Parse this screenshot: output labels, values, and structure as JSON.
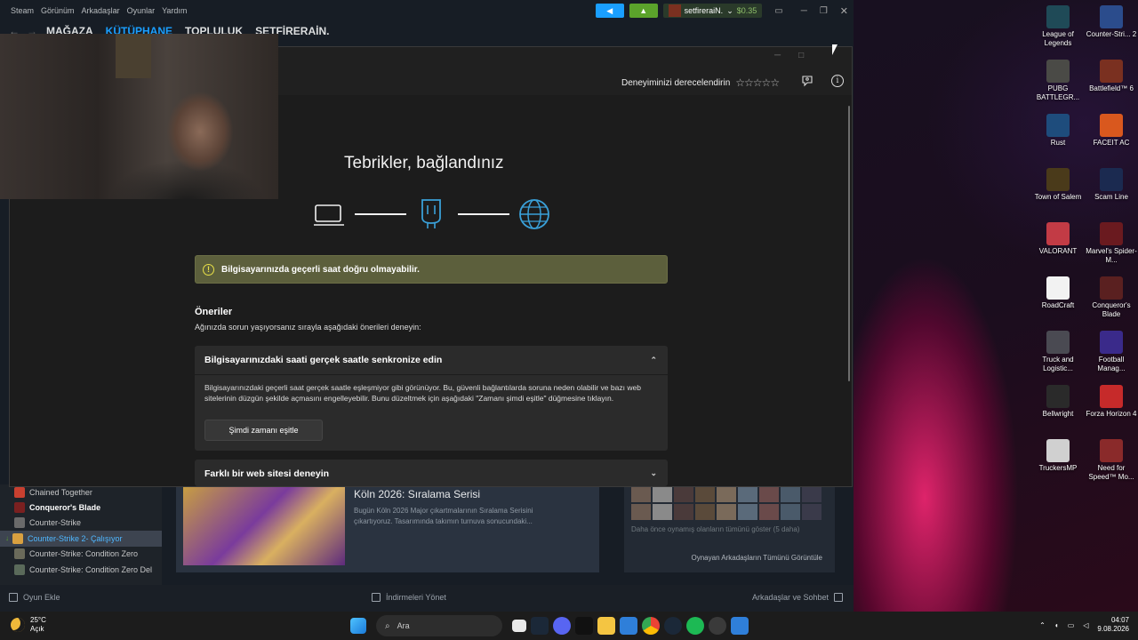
{
  "steam": {
    "menu": [
      "Steam",
      "Görünüm",
      "Arkadaşlar",
      "Oyunlar",
      "Yardım"
    ],
    "user": "setfireraiN.",
    "balance": "$0.35",
    "nav": [
      "MAĞAZA",
      "KÜTÜPHANE",
      "TOPLULUK",
      "SETFİRERAİN."
    ],
    "games": [
      {
        "name": "Chained Together",
        "status": ""
      },
      {
        "name": "Conqueror's Blade",
        "status": ""
      },
      {
        "name": "Counter-Strike",
        "status": ""
      },
      {
        "name": "Counter-Strike 2",
        "status": " - Çalışıyor"
      },
      {
        "name": "Counter-Strike: Condition Zero",
        "status": ""
      },
      {
        "name": "Counter-Strike: Condition Zero Del",
        "status": ""
      }
    ],
    "news": {
      "title": "Köln 2026: Sıralama Serisi",
      "desc": "Bugün Köln 2026 Major çıkartmalarının Sıralama Serisini çıkartıyoruz. Tasarımında takımın turnuva sonucundaki..."
    },
    "friends": {
      "note": "Daha önce oynamış olanların tümünü göster (5 daha)",
      "view_all": "Oynayan Arkadaşların Tümünü Görüntüle"
    },
    "status": {
      "add_game": "Oyun Ekle",
      "downloads": "İndirmeleri Yönet",
      "friends_chat": "Arkadaşlar ve Sohbet"
    }
  },
  "dialog": {
    "rate_label": "Deneyiminizi derecelendirin",
    "title": "Tebrikler, bağlandınız",
    "warning": "Bilgisayarınızda geçerli saat doğru olmayabilir.",
    "suggestions_title": "Öneriler",
    "suggestions_sub": "Ağınızda sorun yaşıyorsanız sırayla aşağıdaki önerileri deneyin:",
    "card1": {
      "title": "Bilgisayarınızdaki saati gerçek saatle senkronize edin",
      "body": "Bilgisayarınızdaki geçerli saat gerçek saatle eşleşmiyor gibi görünüyor. Bu, güvenli bağlantılarda soruna neden olabilir ve bazı web sitelerinin düzgün şekilde açmasını engelleyebilir. Bunu düzeltmek için aşağıdaki \"Zamanı şimdi eşitle\" düğmesine tıklayın.",
      "button": "Şimdi zamanı eşitle"
    },
    "card2": {
      "title": "Farklı bir web sitesi deneyin"
    }
  },
  "desktop": [
    {
      "label": "League of Legends",
      "color": "#1f4a57"
    },
    {
      "label": "Counter-Stri... 2",
      "color": "#2b4c8c"
    },
    {
      "label": "PUBG BATTLEGR...",
      "color": "#4a4a46"
    },
    {
      "label": "Battlefield™ 6",
      "color": "#7a3020"
    },
    {
      "label": "Rust",
      "color": "#1e4c7c"
    },
    {
      "label": "FACEIT AC",
      "color": "#d9581e"
    },
    {
      "label": "Town of Salem",
      "color": "#4a3a1a"
    },
    {
      "label": "Scam Line",
      "color": "#1b2a50"
    },
    {
      "label": "VALORANT",
      "color": "#c23b45"
    },
    {
      "label": "Marvel's Spider-M...",
      "color": "#6a1a1f"
    },
    {
      "label": "RoadCraft",
      "color": "#f2f2f2"
    },
    {
      "label": "Conqueror's Blade",
      "color": "#5a2020"
    },
    {
      "label": "Truck and Logistic...",
      "color": "#4a4a52"
    },
    {
      "label": "Football Manag...",
      "color": "#3a2a8a"
    },
    {
      "label": "Bellwright",
      "color": "#2a2a2a"
    },
    {
      "label": "Forza Horizon 4",
      "color": "#c62a2a"
    },
    {
      "label": "TruckersMP",
      "color": "#d0d0d0"
    },
    {
      "label": "Need for Speed™ Mo...",
      "color": "#8a2a2a"
    }
  ],
  "taskbar": {
    "temp": "25°C",
    "condition": "Açık",
    "search": "Ara",
    "time": "04:07",
    "date": "9.08.2026"
  }
}
